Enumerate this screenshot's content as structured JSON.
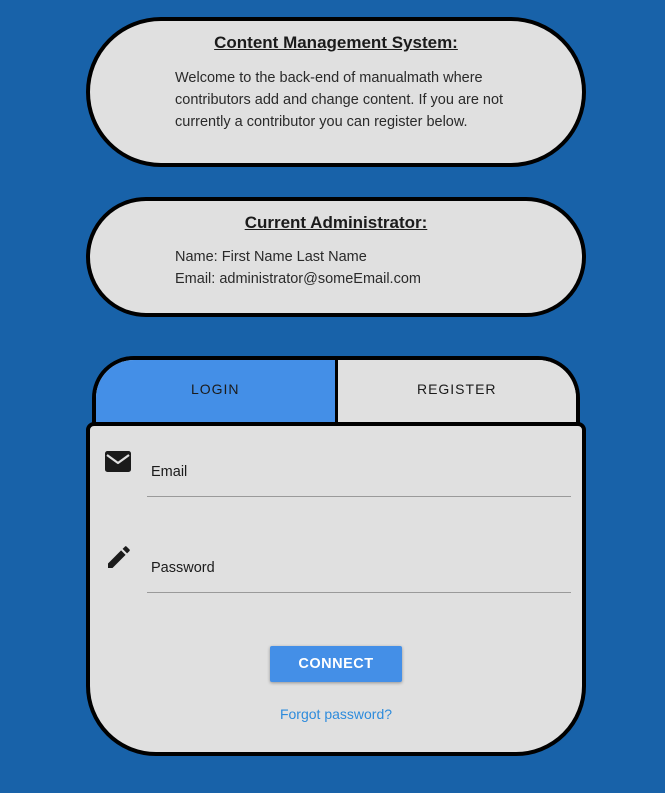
{
  "cms": {
    "title": "Content Management System:",
    "description": "Welcome to the back-end of manualmath where contributors add and change content. If you are not currently a contributor you can register below."
  },
  "admin": {
    "title": "Current Administrator:",
    "name_line": "Name: First Name Last Name",
    "email_line": "Email: administrator@someEmail.com"
  },
  "auth": {
    "tabs": {
      "login": "LOGIN",
      "register": "REGISTER"
    },
    "email_label": "Email",
    "password_label": "Password",
    "connect_label": "CONNECT",
    "forgot_label": "Forgot password?",
    "icons": {
      "email": "email-icon",
      "password": "pencil-icon"
    }
  },
  "colors": {
    "background": "#1862a9",
    "card": "#e0e0e0",
    "accent": "#448fe7",
    "link": "#2d8bdc"
  }
}
